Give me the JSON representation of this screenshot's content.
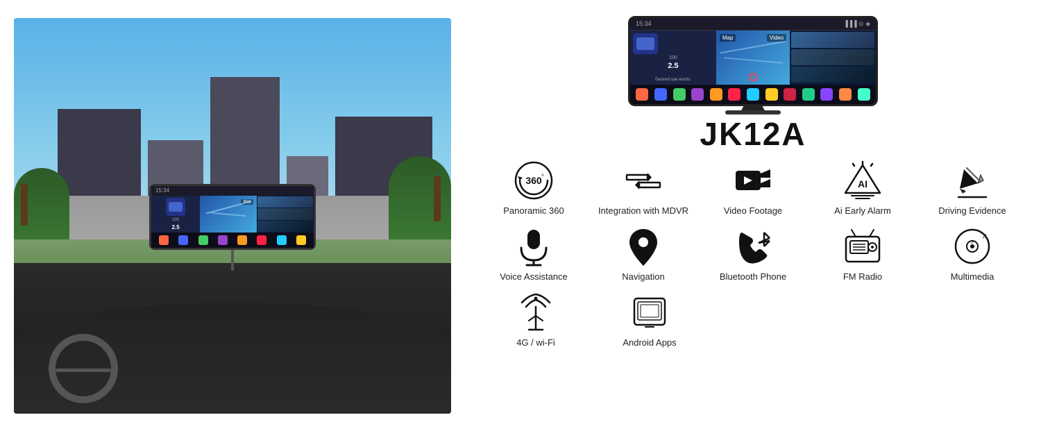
{
  "left": {
    "alt": "Car interior dashboard view with JK12A device mounted"
  },
  "right": {
    "product_title": "JK12A",
    "device_time": "15:34",
    "features_row1": [
      {
        "id": "panoramic-360",
        "label": "Panoramic 360",
        "icon": "360"
      },
      {
        "id": "integration-mdvr",
        "label": "Integration with MDVR",
        "icon": "arrows"
      },
      {
        "id": "video-footage",
        "label": "Video Footage",
        "icon": "video-camera"
      },
      {
        "id": "ai-early-alarm",
        "label": "Ai Early Alarm",
        "icon": "ai-alarm"
      },
      {
        "id": "driving-evidence",
        "label": "Driving Evidence",
        "icon": "pencil"
      }
    ],
    "features_row2": [
      {
        "id": "voice-assistance",
        "label": "Voice Assistance",
        "icon": "microphone"
      },
      {
        "id": "navigation",
        "label": "Navigation",
        "icon": "location-pin"
      },
      {
        "id": "bluetooth-phone",
        "label": "Bluetooth Phone",
        "icon": "bluetooth-phone"
      },
      {
        "id": "fm-radio",
        "label": "FM Radio",
        "icon": "fm-radio"
      },
      {
        "id": "multimedia",
        "label": "Multimedia",
        "icon": "multimedia"
      }
    ],
    "features_row3": [
      {
        "id": "4g-wifi",
        "label": "4G / wi-Fi",
        "icon": "wifi-tower"
      },
      {
        "id": "android-apps",
        "label": "Android Apps",
        "icon": "android-apps"
      }
    ]
  }
}
